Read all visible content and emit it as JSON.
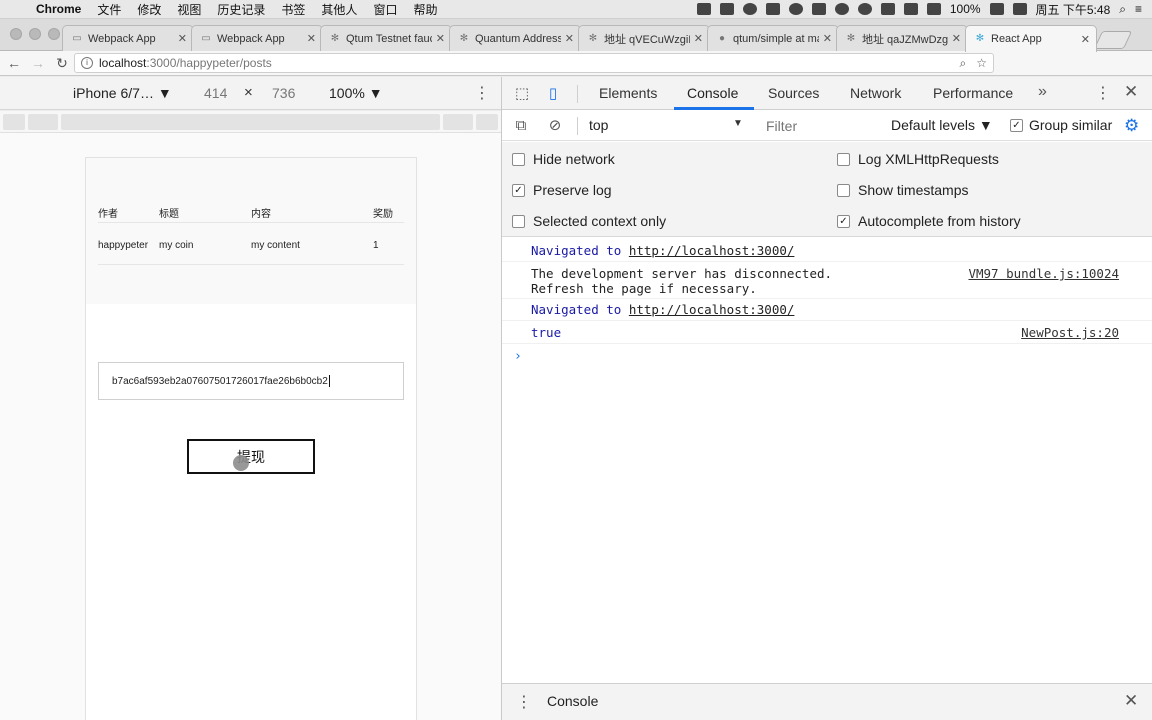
{
  "menubar": {
    "app": "Chrome",
    "items": [
      "文件",
      "修改",
      "视图",
      "历史记录",
      "书签",
      "其他人",
      "窗口",
      "帮助"
    ],
    "battery": "100%",
    "clock": "周五 下午5:48"
  },
  "tabs": [
    {
      "title": "Webpack App",
      "icon": "page-icon"
    },
    {
      "title": "Webpack App",
      "icon": "page-icon"
    },
    {
      "title": "Qtum Testnet fauc",
      "icon": "react-icon"
    },
    {
      "title": "Quantum Address",
      "icon": "react-icon"
    },
    {
      "title": "地址 qVECuWzgiM",
      "icon": "react-icon"
    },
    {
      "title": "qtum/simple at ma",
      "icon": "github-icon"
    },
    {
      "title": "地址 qaJZMwDzgy",
      "icon": "react-icon"
    },
    {
      "title": "React App",
      "icon": "react-icon"
    }
  ],
  "address": {
    "host": "localhost",
    "path": ":3000/happypeter/posts"
  },
  "device_toolbar": {
    "device": "iPhone 6/7…",
    "width": "414",
    "height": "736",
    "zoom": "100%"
  },
  "page": {
    "headers": [
      "作者",
      "标题",
      "内容",
      "奖励"
    ],
    "row": [
      "happypeter",
      "my coin",
      "my content",
      "1"
    ],
    "address_value": "b7ac6af593eb2a07607501726017fae26b6b0cb2",
    "withdraw_label": "提现"
  },
  "devtools": {
    "tabs": [
      "Elements",
      "Console",
      "Sources",
      "Network",
      "Performance"
    ],
    "active_tab": "Console",
    "context": "top",
    "filter_placeholder": "Filter",
    "levels": "Default levels",
    "group_similar": "Group similar",
    "settings": {
      "hide_network": "Hide network",
      "preserve_log": "Preserve log",
      "selected_context": "Selected context only",
      "log_xhr": "Log XMLHttpRequests",
      "show_timestamps": "Show timestamps",
      "autocomplete": "Autocomplete from history"
    },
    "messages": {
      "nav1_prefix": "Navigated to",
      "nav1_url": "http://localhost:3000/",
      "disconnect_line1": "The development server has disconnected.",
      "disconnect_line2": "Refresh the page if necessary.",
      "disconnect_src": "VM97 bundle.js:10024",
      "nav2_prefix": "Navigated to",
      "nav2_url": "http://localhost:3000/",
      "true_value": "true",
      "true_src": "NewPost.js:20"
    },
    "drawer_label": "Console"
  }
}
